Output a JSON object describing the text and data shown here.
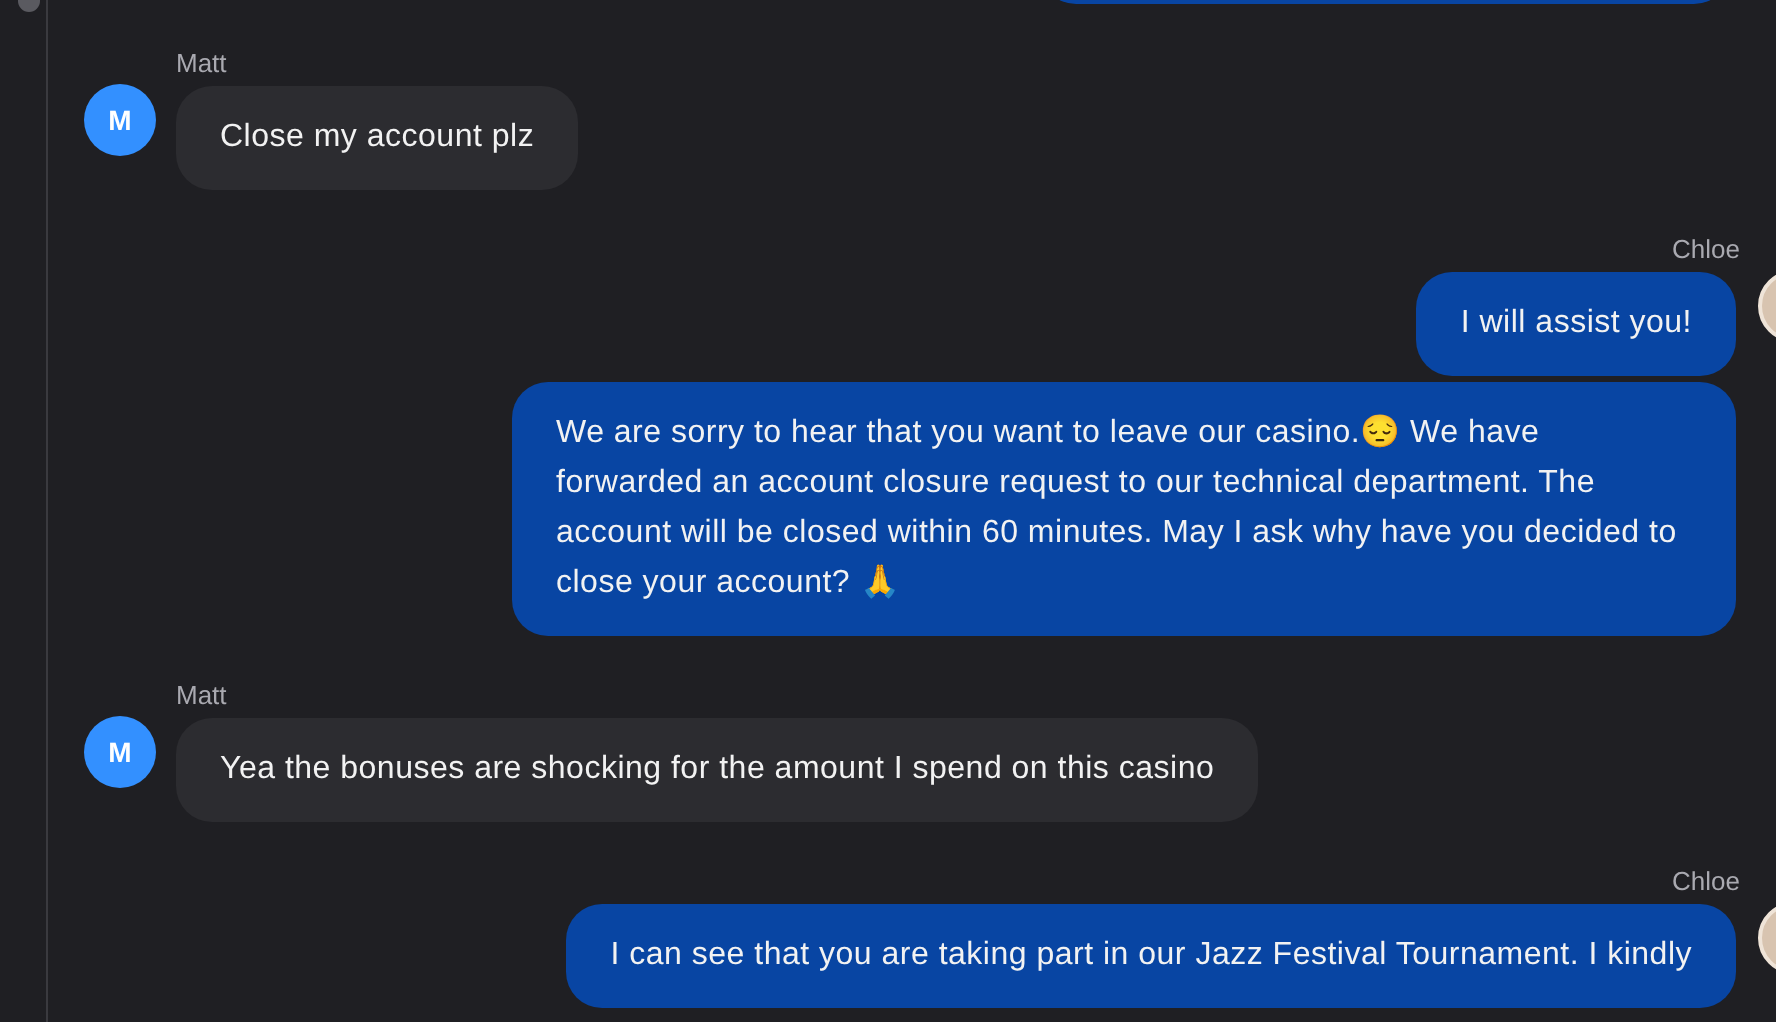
{
  "groups": [
    {
      "kind": "outgoing",
      "bubbles": [
        {
          "kind": "cut"
        }
      ]
    },
    {
      "kind": "incoming",
      "sender": "Matt",
      "avatar": "M",
      "bubbles": [
        {
          "kind": "text",
          "text": "Close my account plz"
        }
      ]
    },
    {
      "kind": "outgoing",
      "sender": "Chloe",
      "bubbles": [
        {
          "kind": "text",
          "text": "I will assist you!"
        },
        {
          "kind": "text",
          "text": "We are sorry to hear that you want to leave our casino.😔 We have forwarded an account closure request to our technical department. The account will be closed within 60 minutes. May I ask why have you decided to close your account? 🙏"
        }
      ]
    },
    {
      "kind": "incoming",
      "sender": "Matt",
      "avatar": "M",
      "bubbles": [
        {
          "kind": "text",
          "text": "Yea the bonuses are shocking for the amount I spend on this casino"
        }
      ]
    },
    {
      "kind": "outgoing",
      "sender": "Chloe",
      "bubbles": [
        {
          "kind": "text",
          "text": "I can see that you are taking part in our Jazz Festival Tournament. I kindly"
        }
      ]
    }
  ]
}
